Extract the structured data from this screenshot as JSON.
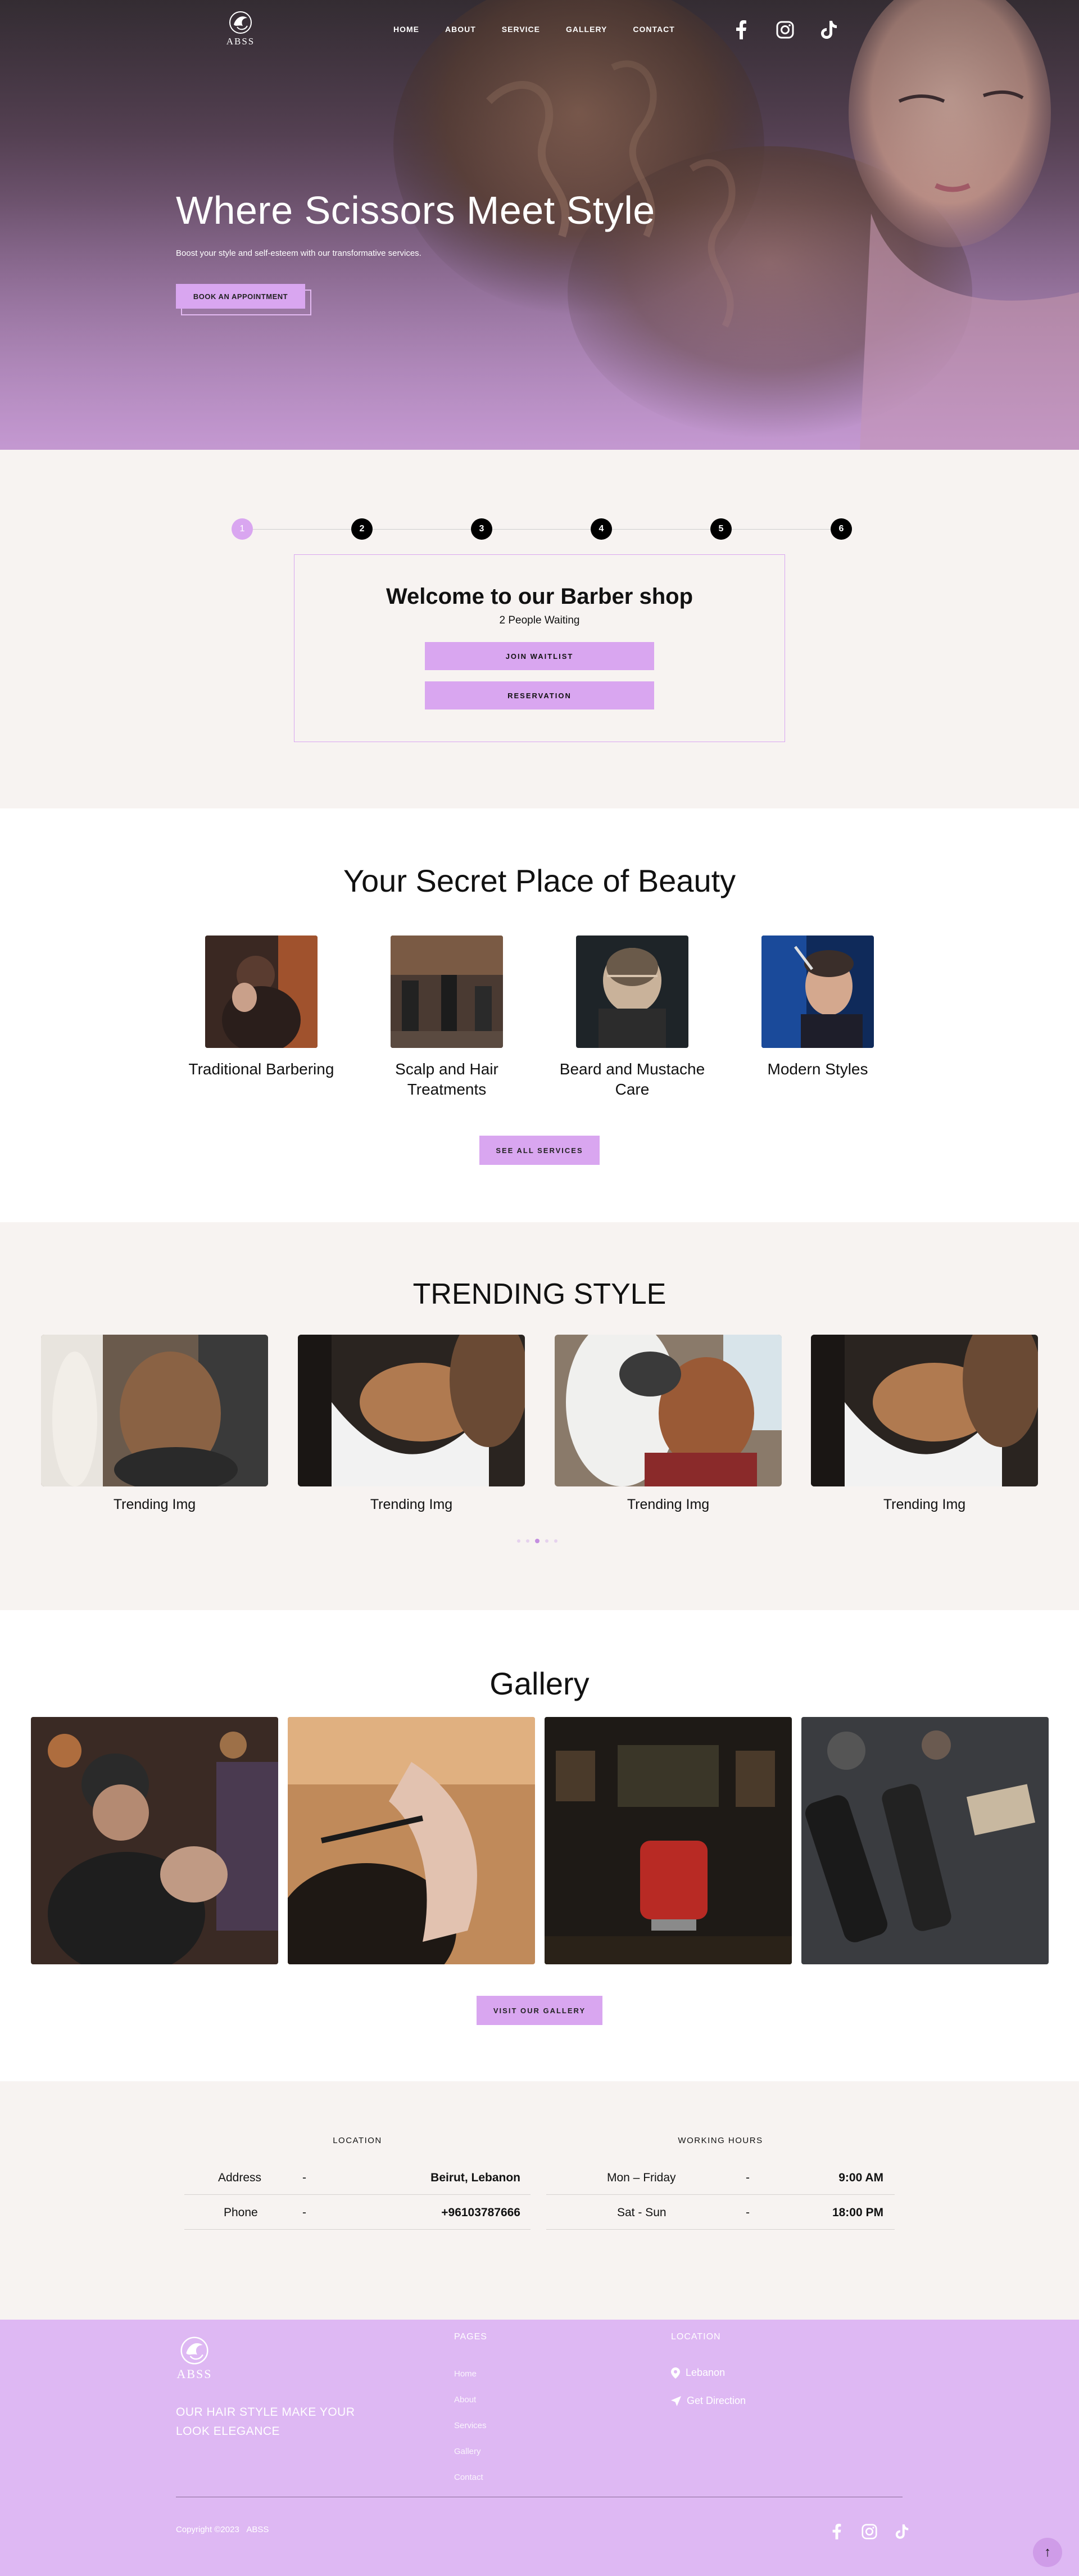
{
  "brand": {
    "name": "ABSS"
  },
  "nav": {
    "items": [
      "HOME",
      "ABOUT",
      "SERVICE",
      "GALLERY",
      "CONTACT"
    ]
  },
  "social": [
    "facebook-icon",
    "instagram-icon",
    "tiktok-icon"
  ],
  "hero": {
    "title": "Where Scissors Meet Style",
    "subtitle": "Boost your style and self-esteem with our transformative services.",
    "cta": "BOOK AN APPOINTMENT"
  },
  "waitlist": {
    "steps": [
      "1",
      "2",
      "3",
      "4",
      "5",
      "6"
    ],
    "active_step": 1,
    "title": "Welcome to our Barber shop",
    "count_text": "2 People Waiting",
    "join_label": "JOIN WAITLIST",
    "reservation_label": "RESERVATION"
  },
  "services": {
    "title": "Your Secret Place of Beauty",
    "items": [
      "Traditional Barbering",
      "Scalp and Hair Treatments",
      "Beard and Mustache Care",
      "Modern Styles"
    ],
    "cta": "SEE ALL SERVICES"
  },
  "trending": {
    "title": "TRENDING STYLE",
    "items": [
      "Trending Img",
      "Trending Img",
      "Trending Img",
      "Trending Img"
    ],
    "page_count": 5,
    "active_page": 3
  },
  "gallery": {
    "title": "Gallery",
    "cta": "VISIT OUR GALLERY"
  },
  "info": {
    "location_heading": "LOCATION",
    "location_rows": [
      {
        "label": "Address",
        "sep": "-",
        "value": "Beirut, Lebanon"
      },
      {
        "label": "Phone",
        "sep": "-",
        "value": "+96103787666"
      }
    ],
    "hours_heading": "WORKING HOURS",
    "hours_rows": [
      {
        "label": "Mon – Friday",
        "sep": "-",
        "value": "9:00 AM"
      },
      {
        "label": "Sat - Sun",
        "sep": "-",
        "value": "18:00 PM"
      }
    ]
  },
  "footer": {
    "tagline": "OUR HAIR STYLE MAKE YOUR LOOK ELEGANCE",
    "pages_heading": "PAGES",
    "pages": [
      "Home",
      "About",
      "Services",
      "Gallery",
      "Contact"
    ],
    "location_heading": "LOCATION",
    "location_text": "Lebanon",
    "direction_text": "Get Direction",
    "copyright": "Copyright ©2023",
    "copyright_brand": "ABSS",
    "back_to_top": "↑"
  },
  "colors": {
    "accent": "#d9a6f0",
    "footer": "#deb8f3",
    "cream": "#f7f3f1"
  }
}
